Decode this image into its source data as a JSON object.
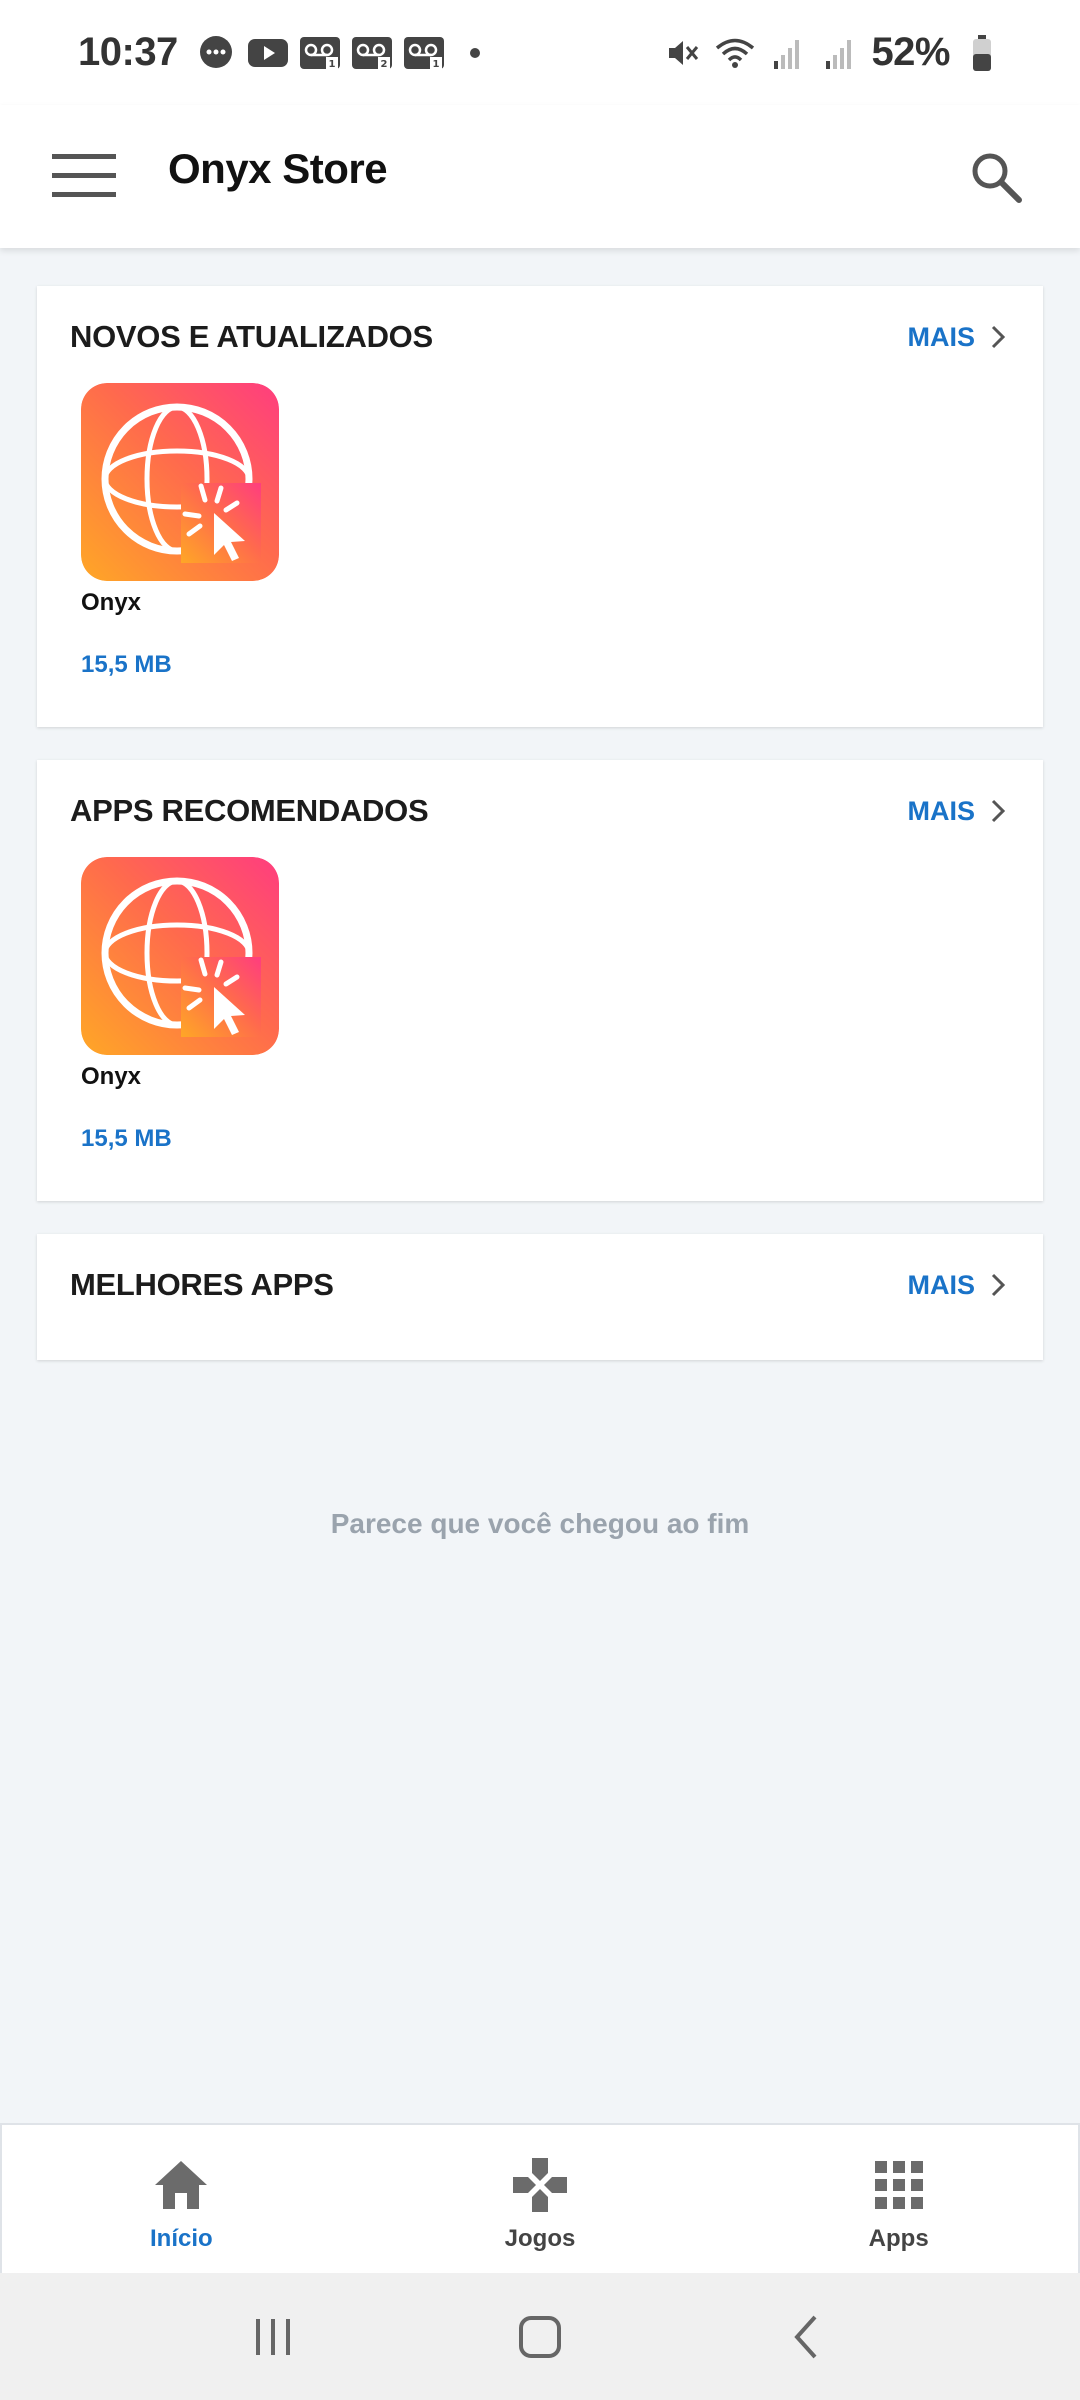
{
  "status_bar": {
    "time": "10:37",
    "battery": "52%",
    "icons_left": [
      "chat-bubble-icon",
      "youtube-icon",
      "voicemail-1-icon",
      "voicemail-2-icon",
      "voicemail-1b-icon",
      "more-dot-icon"
    ],
    "icons_right": [
      "mute-icon",
      "wifi-icon",
      "signal-1-icon",
      "signal-2-icon",
      "battery-icon"
    ]
  },
  "app_bar": {
    "title": "Onyx Store",
    "menu_icon": "hamburger-menu-icon",
    "search_icon": "search-icon"
  },
  "sections": [
    {
      "title": "NOVOS E ATUALIZADOS",
      "more_label": "MAIS",
      "apps": [
        {
          "name": "Onyx",
          "size": "15,5 MB"
        }
      ]
    },
    {
      "title": "APPS RECOMENDADOS",
      "more_label": "MAIS",
      "apps": [
        {
          "name": "Onyx",
          "size": "15,5 MB"
        }
      ]
    },
    {
      "title": "MELHORES APPS",
      "more_label": "MAIS",
      "apps": []
    }
  ],
  "end_message": "Parece que você chegou ao fim",
  "bottom_nav": {
    "items": [
      {
        "label": "Início",
        "icon": "home-icon",
        "active": true
      },
      {
        "label": "Jogos",
        "icon": "gamepad-icon",
        "active": false
      },
      {
        "label": "Apps",
        "icon": "apps-grid-icon",
        "active": false
      }
    ]
  },
  "system_nav": {
    "buttons": [
      "recents-icon",
      "home-circle-icon",
      "back-icon"
    ]
  },
  "colors": {
    "accent": "#1a73c8",
    "background": "#f2f5f8",
    "icon_gradient_start": "#ffa726",
    "icon_gradient_end": "#ff3d7f"
  }
}
